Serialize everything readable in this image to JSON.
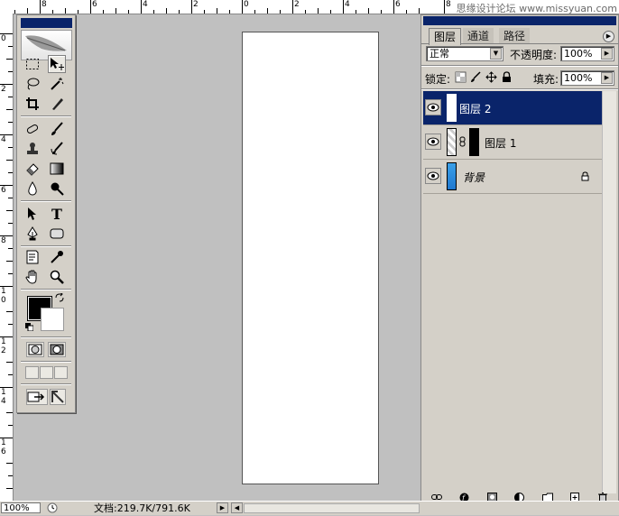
{
  "ruler": {
    "top_labels": [
      "8",
      "6",
      "4",
      "2",
      "0",
      "2",
      "4",
      "6",
      "8"
    ],
    "left_labels": [
      "0",
      "2",
      "4",
      "6",
      "8",
      "1",
      "0",
      "1",
      "2",
      "1",
      "4",
      "1",
      "6"
    ]
  },
  "watermark": "思缘设计论坛  www.missyuan.com",
  "toolbox": {
    "tools": [
      "marquee",
      "move",
      "lasso",
      "magic-wand",
      "crop",
      "slice",
      "healing-brush",
      "brush",
      "clone-stamp",
      "history-brush",
      "eraser",
      "gradient",
      "blur",
      "dodge",
      "path-selection",
      "type",
      "pen",
      "shape",
      "notes",
      "eyedropper",
      "hand",
      "zoom"
    ],
    "type_glyph": "T",
    "foreground_color": "#000000",
    "background_color": "#ffffff"
  },
  "layers_panel": {
    "tabs": [
      "图层",
      "通道",
      "路径"
    ],
    "blend_mode": "正常",
    "opacity_label": "不透明度:",
    "opacity_value": "100%",
    "lock_label": "锁定:",
    "fill_label": "填充:",
    "fill_value": "100%",
    "layers": [
      {
        "name": "图层 2",
        "selected": true,
        "visible": true
      },
      {
        "name": "图层 1",
        "selected": false,
        "visible": true
      },
      {
        "name": "背景",
        "selected": false,
        "visible": true,
        "locked": true
      }
    ]
  },
  "statusbar": {
    "zoom": "100%",
    "doc_info": "文档:219.7K/791.6K"
  },
  "colors": {
    "selection": "#0a246a",
    "panel_bg": "#d4d0c8",
    "workspace": "#c0c0c0",
    "background_layer_fill": "#2a8ad8"
  }
}
